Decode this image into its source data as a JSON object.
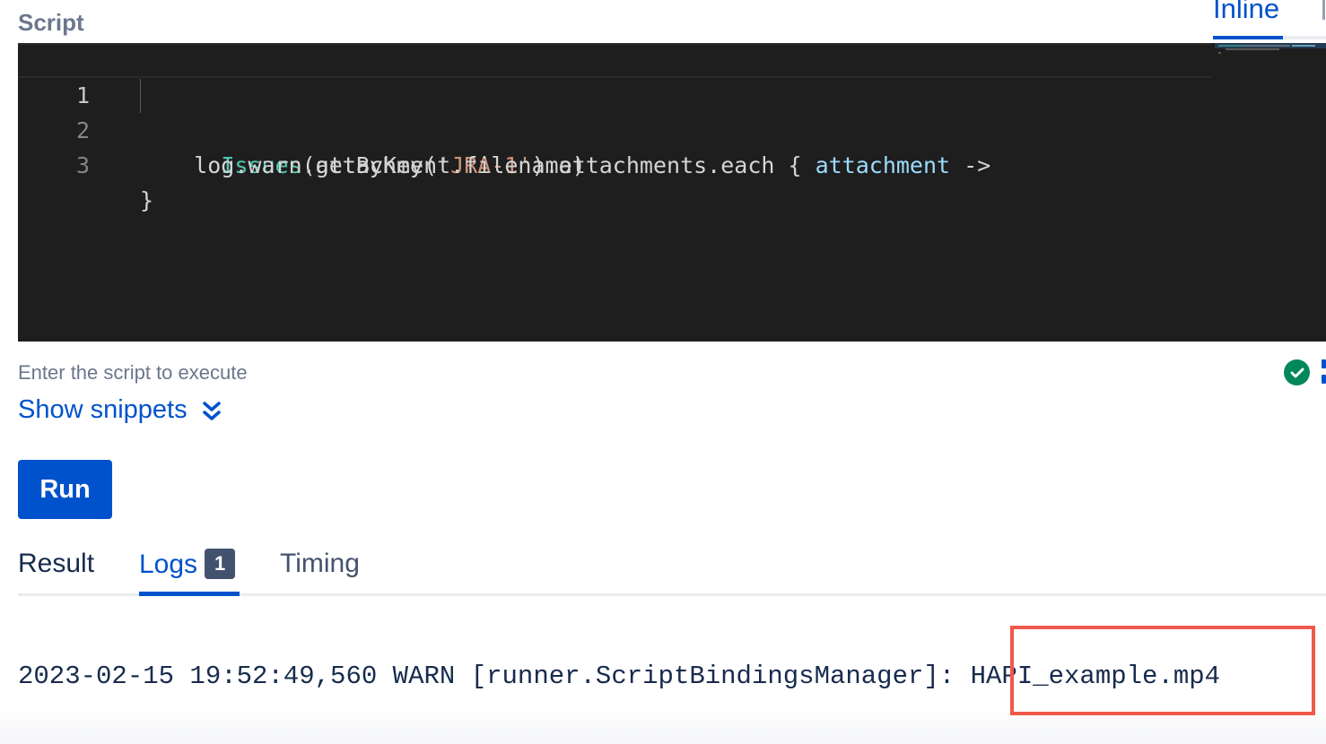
{
  "script_section": {
    "label": "Script",
    "mode_tab": "Inline",
    "code_lines": [
      {
        "number": "1",
        "tokens": [
          {
            "text": "Issues",
            "kind": "class"
          },
          {
            "text": ".getByKey(",
            "kind": "plain"
          },
          {
            "text": "'JRA-1'",
            "kind": "str"
          },
          {
            "text": ").attachments.each { ",
            "kind": "plain"
          },
          {
            "text": "attachment",
            "kind": "param"
          },
          {
            "text": " ->",
            "kind": "plain"
          }
        ]
      },
      {
        "number": "2",
        "tokens": [
          {
            "text": "    log.warn(attachment.filename)",
            "kind": "plain"
          }
        ]
      },
      {
        "number": "3",
        "tokens": [
          {
            "text": "}",
            "kind": "plain"
          }
        ]
      }
    ],
    "helper_text": "Enter the script to execute",
    "status_icon": "check-circle-icon",
    "status_color": "#00875a"
  },
  "snippets": {
    "label": "Show snippets",
    "icon": "double-chevron-down-icon"
  },
  "run_button": {
    "label": "Run",
    "color": "#0052cc"
  },
  "result_tabs": {
    "items": [
      {
        "label": "Result",
        "active": false
      },
      {
        "label": "Logs",
        "active": true,
        "badge": "1"
      },
      {
        "label": "Timing",
        "active": false
      }
    ]
  },
  "logs": {
    "entries": [
      {
        "timestamp": "2023-02-15 19:52:49,560",
        "level": "WARN",
        "source": "[runner.ScriptBindingsManager]:",
        "message": "HAPI_example.mp4"
      }
    ],
    "highlight_color": "#f0584c"
  },
  "colors": {
    "accent": "#0052cc",
    "editor_bg": "#1e1e1e",
    "muted_text": "#6b778c"
  }
}
